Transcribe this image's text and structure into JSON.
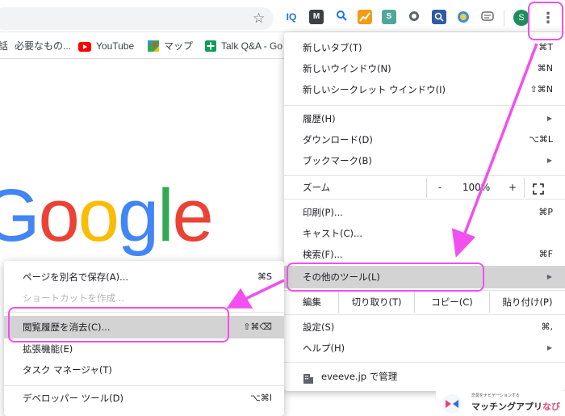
{
  "toolbar": {
    "extensions": [
      {
        "icon": "iq-extension-icon",
        "label": "IQ",
        "color": "#1a73e8"
      },
      {
        "icon": "m-extension-icon",
        "label": "M",
        "color": "#3c4043"
      },
      {
        "icon": "search-extension-icon",
        "label": "🔍",
        "color": "#ffffff"
      },
      {
        "icon": "chart-extension-icon",
        "label": "↗",
        "color": "#f39c12"
      },
      {
        "icon": "s-extension-icon",
        "label": "S",
        "color": "#4ea89a"
      },
      {
        "icon": "circle-extension-icon",
        "label": "◐",
        "color": "#5f6368"
      },
      {
        "icon": "keyhole-extension-icon",
        "label": "⌕",
        "color": "#2e5aa7"
      },
      {
        "icon": "badge-extension-icon",
        "label": "⊙",
        "color": "#3b8fd9"
      },
      {
        "icon": "chat-extension-icon",
        "label": "▤",
        "color": "#6b6b6b"
      }
    ],
    "avatar_initial": "S"
  },
  "bookmarks": [
    {
      "icon": "text",
      "label": "話"
    },
    {
      "icon": "none",
      "label": "必要なもの..."
    },
    {
      "icon": "youtube-icon",
      "label": "YouTube"
    },
    {
      "icon": "maps-icon",
      "label": "マップ"
    },
    {
      "icon": "plus-icon",
      "label": "Talk Q&A - Go"
    }
  ],
  "google_logo": "Google",
  "main_menu": {
    "new_tab": {
      "label": "新しいタブ(T)",
      "shortcut": "⌘T"
    },
    "new_window": {
      "label": "新しいウインドウ(N)",
      "shortcut": "⌘N"
    },
    "new_incognito": {
      "label": "新しいシークレット ウインドウ(I)",
      "shortcut": "⇧⌘N"
    },
    "history": {
      "label": "履歴(H)"
    },
    "downloads": {
      "label": "ダウンロード(D)",
      "shortcut": "⌥⌘L"
    },
    "bookmarks": {
      "label": "ブックマーク(B)"
    },
    "zoom": {
      "label": "ズーム",
      "minus": "-",
      "value": "100%",
      "plus": "+",
      "fullscreen_icon": "fullscreen-icon"
    },
    "print": {
      "label": "印刷(P)...",
      "shortcut": "⌘P"
    },
    "cast": {
      "label": "キャスト(C)..."
    },
    "find": {
      "label": "検索(F)...",
      "shortcut": "⌘F"
    },
    "more_tools": {
      "label": "その他のツール(L)"
    },
    "edit": {
      "label": "編集",
      "cut": "切り取り(T)",
      "copy": "コピー(C)",
      "paste": "貼り付け(P)"
    },
    "settings": {
      "label": "設定(S)",
      "shortcut": "⌘,"
    },
    "help": {
      "label": "ヘルプ(H)"
    },
    "managed": {
      "label": "eveeve.jp で管理"
    }
  },
  "sub_menu": {
    "save_page": {
      "label": "ページを別名で保存(A)...",
      "shortcut": "⌘S"
    },
    "create_shortcut": {
      "label": "ショートカットを作成..."
    },
    "clear_history": {
      "label": "閲覧履歴を消去(C)...",
      "shortcut": "⇧⌘⌫"
    },
    "extensions": {
      "label": "拡張機能(E)"
    },
    "task_manager": {
      "label": "タスク マネージャ(T)"
    },
    "dev_tools": {
      "label": "デベロッパー ツール(D)",
      "shortcut": "⌥⌘I"
    }
  },
  "watermark": {
    "tagline": "恋愛をナビゲーションする",
    "text_main": "マッチングアプリ",
    "text_accent": "なび"
  },
  "colors": {
    "annotation": "#f24ff0",
    "highlight": "#d3d3d3"
  }
}
